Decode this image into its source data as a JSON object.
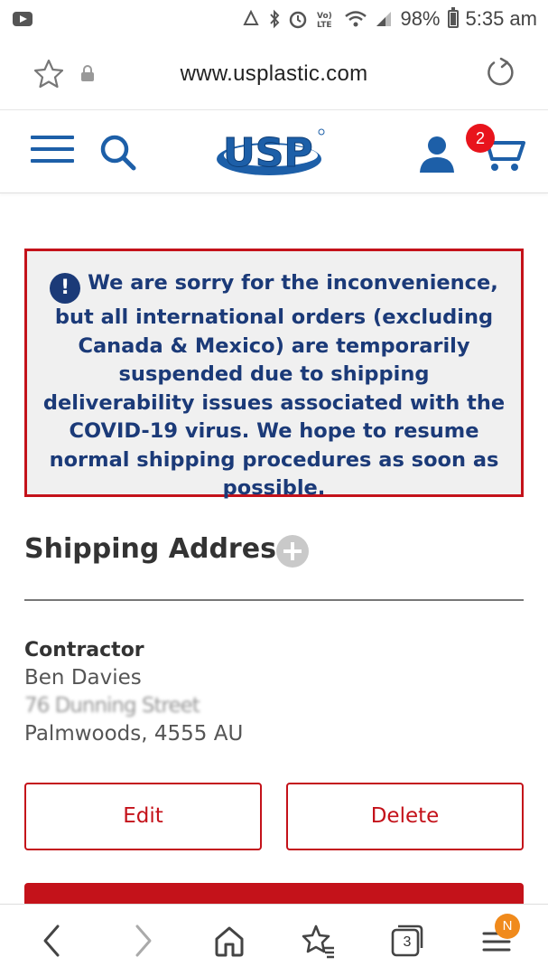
{
  "status_bar": {
    "battery": "98%",
    "time": "5:35 am",
    "icons": [
      "youtube-icon",
      "recycle-icon",
      "bluetooth-icon",
      "alarm-icon",
      "volte-icon",
      "wifi-icon",
      "signal-icon",
      "battery-icon"
    ]
  },
  "browser": {
    "url": "www.usplastic.com"
  },
  "header": {
    "logo_text": "USP",
    "cart_count": "2"
  },
  "notice": {
    "icon": "!",
    "message": "We are sorry for the inconvenience, but all international orders (excluding Canada & Mexico) are temporarily suspended due to shipping deliverability issues associated with the COVID-19 virus. We hope to resume normal shipping procedures as soon as possible."
  },
  "shipping": {
    "title": "Shipping Address",
    "address": {
      "label": "Contractor",
      "name": "Ben Davies",
      "street": "76 Dunning Street",
      "city": "Palmwoods, 4555 AU"
    },
    "edit_label": "Edit",
    "delete_label": "Delete"
  },
  "bottom_nav": {
    "tabs_count": "3",
    "notification_badge": "N"
  },
  "colors": {
    "brand_blue": "#1d5fa8",
    "notice_text": "#1b3a78",
    "accent_red": "#c4121a",
    "badge_red": "#e8141c",
    "badge_orange": "#f08a1c"
  }
}
